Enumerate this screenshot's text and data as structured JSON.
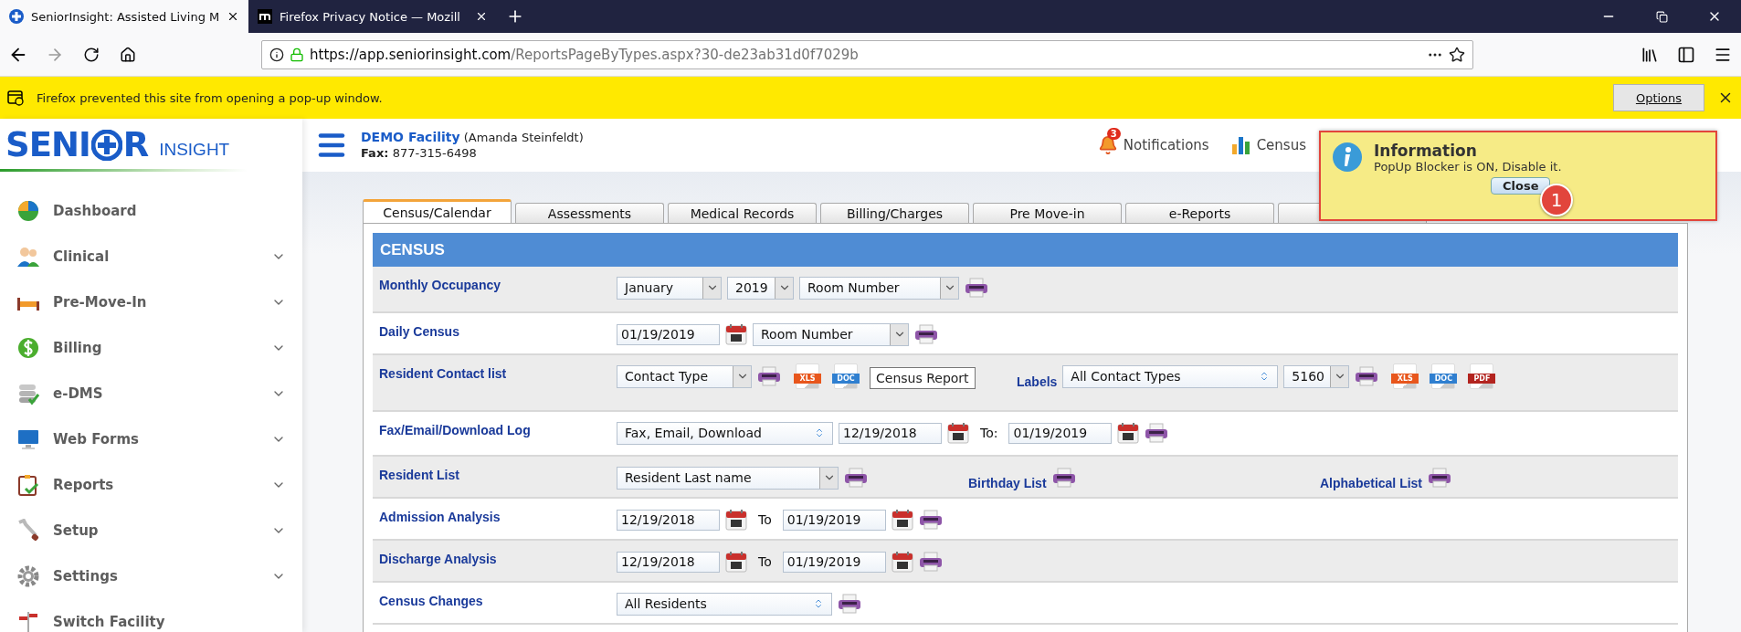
{
  "browser": {
    "tabs": [
      {
        "title": "SeniorInsight: Assisted Living M",
        "selected": true,
        "kind": "cross"
      },
      {
        "title": "Firefox Privacy Notice — Mozill",
        "selected": false,
        "kind": "mozilla"
      }
    ],
    "url": {
      "host": "https://app.seniorinsight.com",
      "path": "/ReportsPageByTypes.aspx?30-de23ab31d0f7029b"
    },
    "notification": {
      "message": "Firefox prevented this site from opening a pop-up window.",
      "button": "Options"
    }
  },
  "logo": {
    "part1": "SENI",
    "part2": "R",
    "tagline": "INSIGHT"
  },
  "facility": {
    "name": "DEMO Facility",
    "user": "(Amanda Steinfeldt)",
    "fax_label": "Fax:",
    "fax": "877-315-6498"
  },
  "header_links": [
    {
      "label": "Notifications",
      "badge": "3",
      "kind": "bell"
    },
    {
      "label": "Census",
      "kind": "chart"
    }
  ],
  "sidebar": [
    {
      "label": "Dashboard",
      "kind": "pie",
      "expandable": false
    },
    {
      "label": "Clinical",
      "kind": "people",
      "expandable": true
    },
    {
      "label": "Pre-Move-In",
      "kind": "bed",
      "expandable": true
    },
    {
      "label": "Billing",
      "kind": "dollar",
      "expandable": true
    },
    {
      "label": "e-DMS",
      "kind": "stack",
      "expandable": true
    },
    {
      "label": "Web Forms",
      "kind": "monitor",
      "expandable": true
    },
    {
      "label": "Reports",
      "kind": "clipboard",
      "expandable": true
    },
    {
      "label": "Setup",
      "kind": "wrench",
      "expandable": true
    },
    {
      "label": "Settings",
      "kind": "gear",
      "expandable": true
    },
    {
      "label": "Switch Facility",
      "kind": "signpost",
      "expandable": false
    }
  ],
  "tabs": [
    {
      "label": "Census/Calendar",
      "selected": true
    },
    {
      "label": "Assessments",
      "selected": false
    },
    {
      "label": "Medical Records",
      "selected": false
    },
    {
      "label": "Billing/Charges",
      "selected": false
    },
    {
      "label": "Pre Move-in",
      "selected": false
    },
    {
      "label": "e-Reports",
      "selected": false
    },
    {
      "selected": false
    }
  ],
  "section_title": "CENSUS",
  "rows": [
    {
      "label": "Monthly Occupancy",
      "groups": [
        [
          {
            "kind": "select",
            "value": "January"
          },
          {
            "kind": "select",
            "value": "2019"
          },
          {
            "kind": "select",
            "value": "Room Number"
          },
          {
            "kind": "print"
          }
        ]
      ]
    },
    {
      "label": "Daily Census",
      "groups": [
        [
          {
            "kind": "date",
            "value": "01/19/2019"
          },
          {
            "kind": "calendar"
          },
          {
            "kind": "select",
            "value": "Room Number"
          },
          {
            "kind": "print"
          }
        ]
      ]
    },
    {
      "label": "Resident Contact list",
      "groups": [
        [
          {
            "kind": "select",
            "value": "Contact Type"
          },
          {
            "kind": "print"
          },
          {
            "kind": "file",
            "value": "XLS",
            "color": "#e8561c"
          },
          {
            "kind": "file",
            "value": "DOC",
            "color": "#2f7fd0"
          }
        ],
        [
          {
            "kind": "link",
            "value": "Labels"
          },
          {
            "kind": "listbox",
            "value": "All Contact Types"
          },
          {
            "kind": "select",
            "value": "5160"
          },
          {
            "kind": "print"
          },
          {
            "kind": "file",
            "value": "XLS",
            "color": "#e8561c"
          },
          {
            "kind": "file",
            "value": "DOC",
            "color": "#2f7fd0"
          },
          {
            "kind": "file",
            "value": "PDF",
            "color": "#b3241f"
          }
        ]
      ]
    },
    {
      "label": "Fax/Email/Download Log",
      "groups": [
        [
          {
            "kind": "listbox",
            "value": "Fax, Email, Download"
          },
          {
            "kind": "date",
            "value": "12/19/2018"
          },
          {
            "kind": "calendar"
          },
          {
            "kind": "text",
            "value": "To:"
          },
          {
            "kind": "date",
            "value": "01/19/2019"
          },
          {
            "kind": "calendar"
          },
          {
            "kind": "print"
          }
        ]
      ]
    },
    {
      "label": "Resident List",
      "groups": [
        [
          {
            "kind": "select",
            "value": "Resident Last name"
          },
          {
            "kind": "print"
          }
        ],
        [
          {
            "kind": "link",
            "value": "Birthday List"
          },
          {
            "kind": "print"
          }
        ],
        [
          {
            "kind": "link",
            "value": "Alphabetical List"
          },
          {
            "kind": "print"
          }
        ]
      ]
    },
    {
      "label": "Admission Analysis",
      "groups": [
        [
          {
            "kind": "date",
            "value": "12/19/2018"
          },
          {
            "kind": "calendar"
          },
          {
            "kind": "text",
            "value": "To"
          },
          {
            "kind": "date",
            "value": "01/19/2019"
          },
          {
            "kind": "calendar"
          },
          {
            "kind": "print"
          }
        ]
      ]
    },
    {
      "label": "Discharge Analysis",
      "groups": [
        [
          {
            "kind": "date",
            "value": "12/19/2018"
          },
          {
            "kind": "calendar"
          },
          {
            "kind": "text",
            "value": "To"
          },
          {
            "kind": "date",
            "value": "01/19/2019"
          },
          {
            "kind": "calendar"
          },
          {
            "kind": "print"
          }
        ]
      ]
    },
    {
      "label": "Census Changes",
      "groups": [
        [
          {
            "kind": "listbox",
            "value": "All Residents"
          },
          {
            "kind": "print"
          }
        ]
      ]
    }
  ],
  "tooltip": "Census Report",
  "popup": {
    "title": "Information",
    "message": "PopUp Blocker is ON, Disable it.",
    "button": "Close",
    "step": "1"
  }
}
